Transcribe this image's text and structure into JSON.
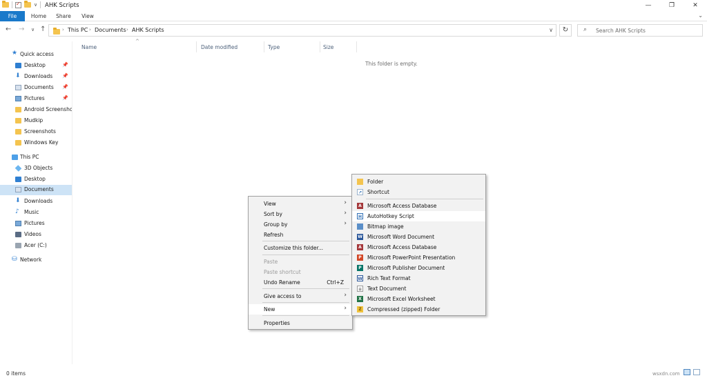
{
  "window": {
    "title": "AHK Scripts",
    "controls": {
      "minimize": "—",
      "restore": "❐",
      "close": "✕"
    }
  },
  "ribbon": {
    "tabs": [
      "File",
      "Home",
      "Share",
      "View"
    ],
    "expand_icon": "chevron-down-icon"
  },
  "nav": {
    "back": "←",
    "forward": "→",
    "recent": "∨",
    "up": "↑",
    "breadcrumb": [
      "This PC",
      "Documents",
      "AHK Scripts"
    ],
    "dropdown": "∨",
    "refresh": "↻",
    "search_placeholder": "Search AHK Scripts"
  },
  "sidebar": {
    "quick_access": {
      "label": "Quick access",
      "items": [
        {
          "label": "Desktop",
          "pinned": true
        },
        {
          "label": "Downloads",
          "pinned": true
        },
        {
          "label": "Documents",
          "pinned": true
        },
        {
          "label": "Pictures",
          "pinned": true
        },
        {
          "label": "Android Screenshot"
        },
        {
          "label": "Mudkip"
        },
        {
          "label": "Screenshots"
        },
        {
          "label": "Windows Key"
        }
      ]
    },
    "this_pc": {
      "label": "This PC",
      "items": [
        "3D Objects",
        "Desktop",
        "Documents",
        "Downloads",
        "Music",
        "Pictures",
        "Videos",
        "Acer (C:)"
      ],
      "selected": "Documents"
    },
    "network": {
      "label": "Network"
    }
  },
  "columns": [
    "Name",
    "Date modified",
    "Type",
    "Size"
  ],
  "empty_message": "This folder is empty.",
  "status": {
    "items": "0 items"
  },
  "context_menu": {
    "view": "View",
    "sort_by": "Sort by",
    "group_by": "Group by",
    "refresh": "Refresh",
    "customize": "Customize this folder...",
    "paste": "Paste",
    "paste_shortcut": "Paste shortcut",
    "undo_rename": "Undo Rename",
    "undo_shortcut": "Ctrl+Z",
    "give_access": "Give access to",
    "new": "New",
    "properties": "Properties"
  },
  "new_submenu": {
    "items": [
      "Folder",
      "Shortcut",
      "Microsoft Access Database",
      "AutoHotkey Script",
      "Bitmap image",
      "Microsoft Word Document",
      "Microsoft Access Database",
      "Microsoft PowerPoint Presentation",
      "Microsoft Publisher Document",
      "Rich Text Format",
      "Text Document",
      "Microsoft Excel Worksheet",
      "Compressed (zipped) Folder"
    ],
    "highlighted": "AutoHotkey Script"
  },
  "watermark": "wsxdn.com",
  "colors": {
    "accent": "#1979ca",
    "selected": "#cde3f6",
    "menu_bg": "#f2f2f2"
  }
}
